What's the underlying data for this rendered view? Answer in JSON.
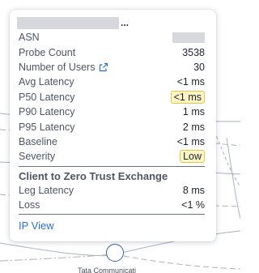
{
  "tooltip": {
    "title_suffix": "...",
    "metrics": [
      {
        "label": "ASN",
        "value": ""
      },
      {
        "label": "Probe Count",
        "value": "3538"
      },
      {
        "label": "Number of Users",
        "value": "30",
        "icon": "external-link-icon"
      },
      {
        "label": "Avg Latency",
        "value": "<1 ms"
      },
      {
        "label": "P50 Latency",
        "value": "<1 ms",
        "highlight": true
      },
      {
        "label": "P90 Latency",
        "value": "1 ms"
      },
      {
        "label": "P95 Latency",
        "value": "2 ms"
      },
      {
        "label": "Baseline",
        "value": "<1 ms"
      },
      {
        "label": "Severity",
        "value": "Low",
        "highlight": true
      }
    ],
    "section": {
      "heading": "Client to Zero Trust Exchange",
      "metrics": [
        {
          "label": "Leg Latency",
          "value": "8 ms"
        },
        {
          "label": "Loss",
          "value": "<1 %"
        }
      ]
    },
    "link_label": "IP View"
  },
  "graph": {
    "node_label": "Tata Communicati"
  },
  "colors": {
    "link": "#2a6fdb",
    "badge_bg": "#fff6c7",
    "badge_border": "#e7c64a",
    "node_stroke": "#3f5f9f",
    "edge": "#aab1bf"
  }
}
